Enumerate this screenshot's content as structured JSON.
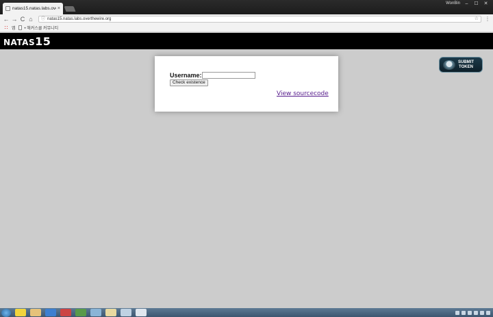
{
  "browser": {
    "tab_title": "natas15.natas.labs.overt",
    "tab_close": "×",
    "user_name": "WonBin",
    "win_min": "–",
    "win_max": "☐",
    "win_close": "✕",
    "back": "←",
    "forward": "→",
    "reload": "C",
    "home": "⌂",
    "info_icon": "ⓘ",
    "url": "natas15.natas.labs.overthewire.org",
    "star": "☆",
    "menu": "⋮"
  },
  "bookmarks": {
    "apps_label": "앱",
    "item_label": "• 해커스쿨 커뮤니티"
  },
  "page": {
    "title_prefix": "NATAS",
    "title_number": "15",
    "username_label": "Username:",
    "username_value": "",
    "check_button": "Check existence",
    "source_link": "View sourcecode"
  },
  "token_badge": {
    "line1": "SUBMIT",
    "line2": "TOKEN"
  },
  "colors": {
    "page_bg": "#cccccc",
    "header_bg": "#000000",
    "link": "#551a8b"
  },
  "icons": [
    "info-icon",
    "star-icon",
    "menu-icon",
    "apps-icon",
    "wechall-logo-icon"
  ]
}
